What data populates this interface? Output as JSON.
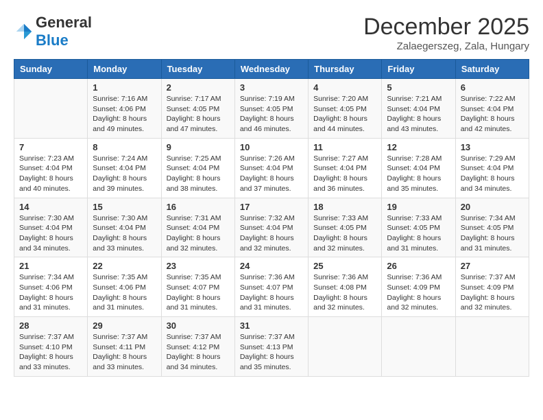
{
  "logo": {
    "general": "General",
    "blue": "Blue"
  },
  "title": {
    "month": "December 2025",
    "location": "Zalaegerszeg, Zala, Hungary"
  },
  "headers": [
    "Sunday",
    "Monday",
    "Tuesday",
    "Wednesday",
    "Thursday",
    "Friday",
    "Saturday"
  ],
  "weeks": [
    [
      {
        "day": "",
        "info": ""
      },
      {
        "day": "1",
        "info": "Sunrise: 7:16 AM\nSunset: 4:06 PM\nDaylight: 8 hours\nand 49 minutes."
      },
      {
        "day": "2",
        "info": "Sunrise: 7:17 AM\nSunset: 4:05 PM\nDaylight: 8 hours\nand 47 minutes."
      },
      {
        "day": "3",
        "info": "Sunrise: 7:19 AM\nSunset: 4:05 PM\nDaylight: 8 hours\nand 46 minutes."
      },
      {
        "day": "4",
        "info": "Sunrise: 7:20 AM\nSunset: 4:05 PM\nDaylight: 8 hours\nand 44 minutes."
      },
      {
        "day": "5",
        "info": "Sunrise: 7:21 AM\nSunset: 4:04 PM\nDaylight: 8 hours\nand 43 minutes."
      },
      {
        "day": "6",
        "info": "Sunrise: 7:22 AM\nSunset: 4:04 PM\nDaylight: 8 hours\nand 42 minutes."
      }
    ],
    [
      {
        "day": "7",
        "info": "Sunrise: 7:23 AM\nSunset: 4:04 PM\nDaylight: 8 hours\nand 40 minutes."
      },
      {
        "day": "8",
        "info": "Sunrise: 7:24 AM\nSunset: 4:04 PM\nDaylight: 8 hours\nand 39 minutes."
      },
      {
        "day": "9",
        "info": "Sunrise: 7:25 AM\nSunset: 4:04 PM\nDaylight: 8 hours\nand 38 minutes."
      },
      {
        "day": "10",
        "info": "Sunrise: 7:26 AM\nSunset: 4:04 PM\nDaylight: 8 hours\nand 37 minutes."
      },
      {
        "day": "11",
        "info": "Sunrise: 7:27 AM\nSunset: 4:04 PM\nDaylight: 8 hours\nand 36 minutes."
      },
      {
        "day": "12",
        "info": "Sunrise: 7:28 AM\nSunset: 4:04 PM\nDaylight: 8 hours\nand 35 minutes."
      },
      {
        "day": "13",
        "info": "Sunrise: 7:29 AM\nSunset: 4:04 PM\nDaylight: 8 hours\nand 34 minutes."
      }
    ],
    [
      {
        "day": "14",
        "info": "Sunrise: 7:30 AM\nSunset: 4:04 PM\nDaylight: 8 hours\nand 34 minutes."
      },
      {
        "day": "15",
        "info": "Sunrise: 7:30 AM\nSunset: 4:04 PM\nDaylight: 8 hours\nand 33 minutes."
      },
      {
        "day": "16",
        "info": "Sunrise: 7:31 AM\nSunset: 4:04 PM\nDaylight: 8 hours\nand 32 minutes."
      },
      {
        "day": "17",
        "info": "Sunrise: 7:32 AM\nSunset: 4:04 PM\nDaylight: 8 hours\nand 32 minutes."
      },
      {
        "day": "18",
        "info": "Sunrise: 7:33 AM\nSunset: 4:05 PM\nDaylight: 8 hours\nand 32 minutes."
      },
      {
        "day": "19",
        "info": "Sunrise: 7:33 AM\nSunset: 4:05 PM\nDaylight: 8 hours\nand 31 minutes."
      },
      {
        "day": "20",
        "info": "Sunrise: 7:34 AM\nSunset: 4:05 PM\nDaylight: 8 hours\nand 31 minutes."
      }
    ],
    [
      {
        "day": "21",
        "info": "Sunrise: 7:34 AM\nSunset: 4:06 PM\nDaylight: 8 hours\nand 31 minutes."
      },
      {
        "day": "22",
        "info": "Sunrise: 7:35 AM\nSunset: 4:06 PM\nDaylight: 8 hours\nand 31 minutes."
      },
      {
        "day": "23",
        "info": "Sunrise: 7:35 AM\nSunset: 4:07 PM\nDaylight: 8 hours\nand 31 minutes."
      },
      {
        "day": "24",
        "info": "Sunrise: 7:36 AM\nSunset: 4:07 PM\nDaylight: 8 hours\nand 31 minutes."
      },
      {
        "day": "25",
        "info": "Sunrise: 7:36 AM\nSunset: 4:08 PM\nDaylight: 8 hours\nand 32 minutes."
      },
      {
        "day": "26",
        "info": "Sunrise: 7:36 AM\nSunset: 4:09 PM\nDaylight: 8 hours\nand 32 minutes."
      },
      {
        "day": "27",
        "info": "Sunrise: 7:37 AM\nSunset: 4:09 PM\nDaylight: 8 hours\nand 32 minutes."
      }
    ],
    [
      {
        "day": "28",
        "info": "Sunrise: 7:37 AM\nSunset: 4:10 PM\nDaylight: 8 hours\nand 33 minutes."
      },
      {
        "day": "29",
        "info": "Sunrise: 7:37 AM\nSunset: 4:11 PM\nDaylight: 8 hours\nand 33 minutes."
      },
      {
        "day": "30",
        "info": "Sunrise: 7:37 AM\nSunset: 4:12 PM\nDaylight: 8 hours\nand 34 minutes."
      },
      {
        "day": "31",
        "info": "Sunrise: 7:37 AM\nSunset: 4:13 PM\nDaylight: 8 hours\nand 35 minutes."
      },
      {
        "day": "",
        "info": ""
      },
      {
        "day": "",
        "info": ""
      },
      {
        "day": "",
        "info": ""
      }
    ]
  ]
}
